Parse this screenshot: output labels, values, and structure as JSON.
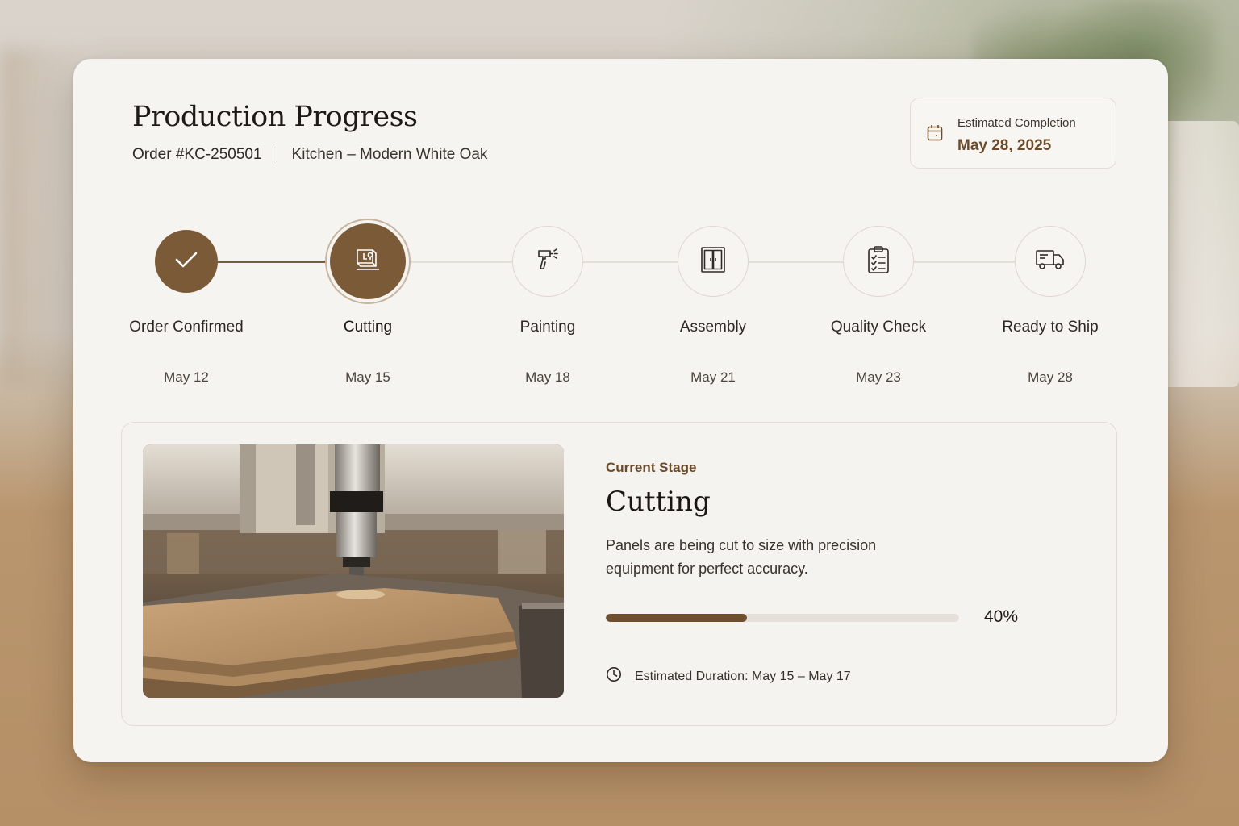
{
  "header": {
    "title": "Production Progress",
    "order_number": "Order #KC-250501",
    "order_description": "Kitchen – Modern White Oak"
  },
  "estimated_completion": {
    "label": "Estimated Completion",
    "date": "May 28, 2025",
    "icon": "calendar-icon"
  },
  "steps": [
    {
      "label": "Order Confirmed",
      "date": "May 12",
      "status": "completed",
      "icon": "check-icon"
    },
    {
      "label": "Cutting",
      "date": "May 15",
      "status": "current",
      "icon": "cnc-cutting-icon"
    },
    {
      "label": "Painting",
      "date": "May 18",
      "status": "upcoming",
      "icon": "spray-gun-icon"
    },
    {
      "label": "Assembly",
      "date": "May 21",
      "status": "upcoming",
      "icon": "cabinet-icon"
    },
    {
      "label": "Quality Check",
      "date": "May 23",
      "status": "upcoming",
      "icon": "clipboard-check-icon"
    },
    {
      "label": "Ready to Ship",
      "date": "May 28",
      "status": "upcoming",
      "icon": "truck-icon"
    }
  ],
  "current_stage": {
    "eyebrow": "Current Stage",
    "title": "Cutting",
    "description": "Panels are being cut to size with precision equipment for perfect accuracy.",
    "progress": 0.4,
    "progress_label": "40%",
    "duration": "Estimated Duration: May 15 – May 17",
    "duration_icon": "clock-icon"
  },
  "colors": {
    "accent": "#7b5a38",
    "accent_text": "#6b4a2a",
    "track": "#e4dfd8",
    "card": "#f6f4f0"
  }
}
